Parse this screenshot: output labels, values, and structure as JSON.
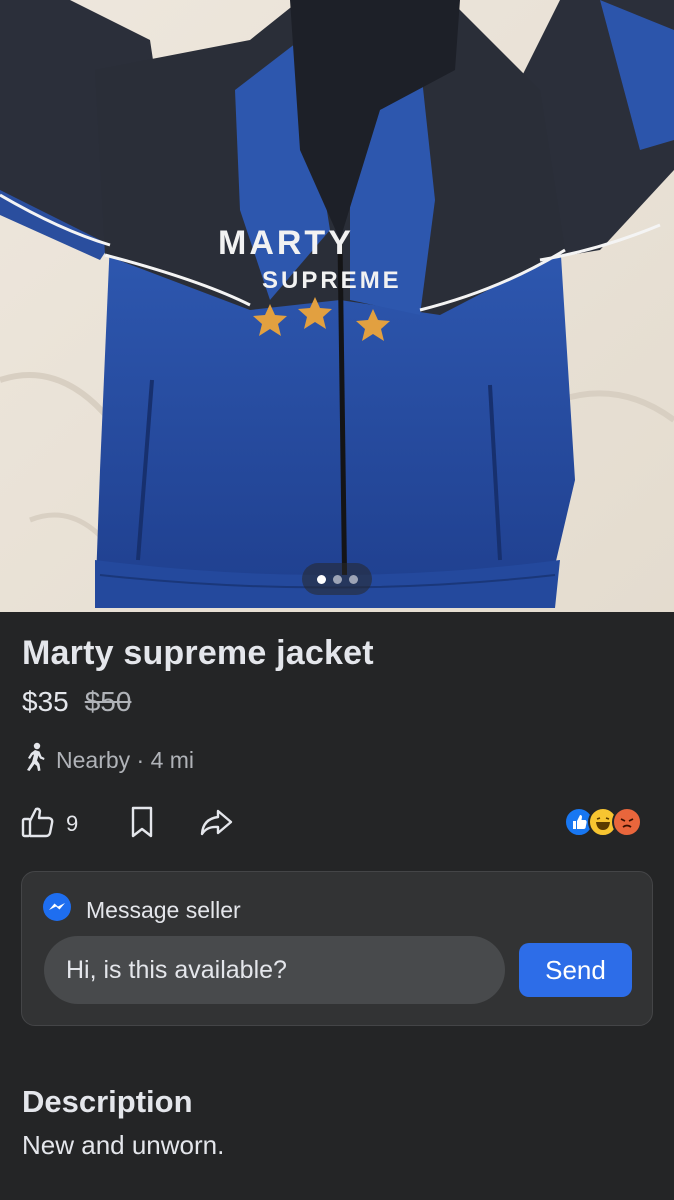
{
  "listing": {
    "title": "Marty supreme jacket",
    "price": "$35",
    "original_price": "$50",
    "location": "Nearby · 4 mi",
    "photo_print": {
      "line1": "MARTY",
      "line2": "SUPREME"
    },
    "gallery": {
      "photo_count": 3,
      "active_index": 0
    }
  },
  "actions": {
    "like_count": "9",
    "icons": [
      "thumbs-up-icon",
      "bookmark-icon",
      "share-icon"
    ],
    "reactions": [
      "like-reaction",
      "haha-reaction",
      "angry-reaction"
    ]
  },
  "message": {
    "header": "Message seller",
    "input_value": "Hi, is this available?",
    "send_label": "Send"
  },
  "description": {
    "heading": "Description",
    "text": "New and unworn."
  },
  "colors": {
    "background": "#242526",
    "card": "#323334",
    "accent": "#2d6de8",
    "text_primary": "#e4e6eb",
    "text_secondary": "#b0b3b8"
  }
}
